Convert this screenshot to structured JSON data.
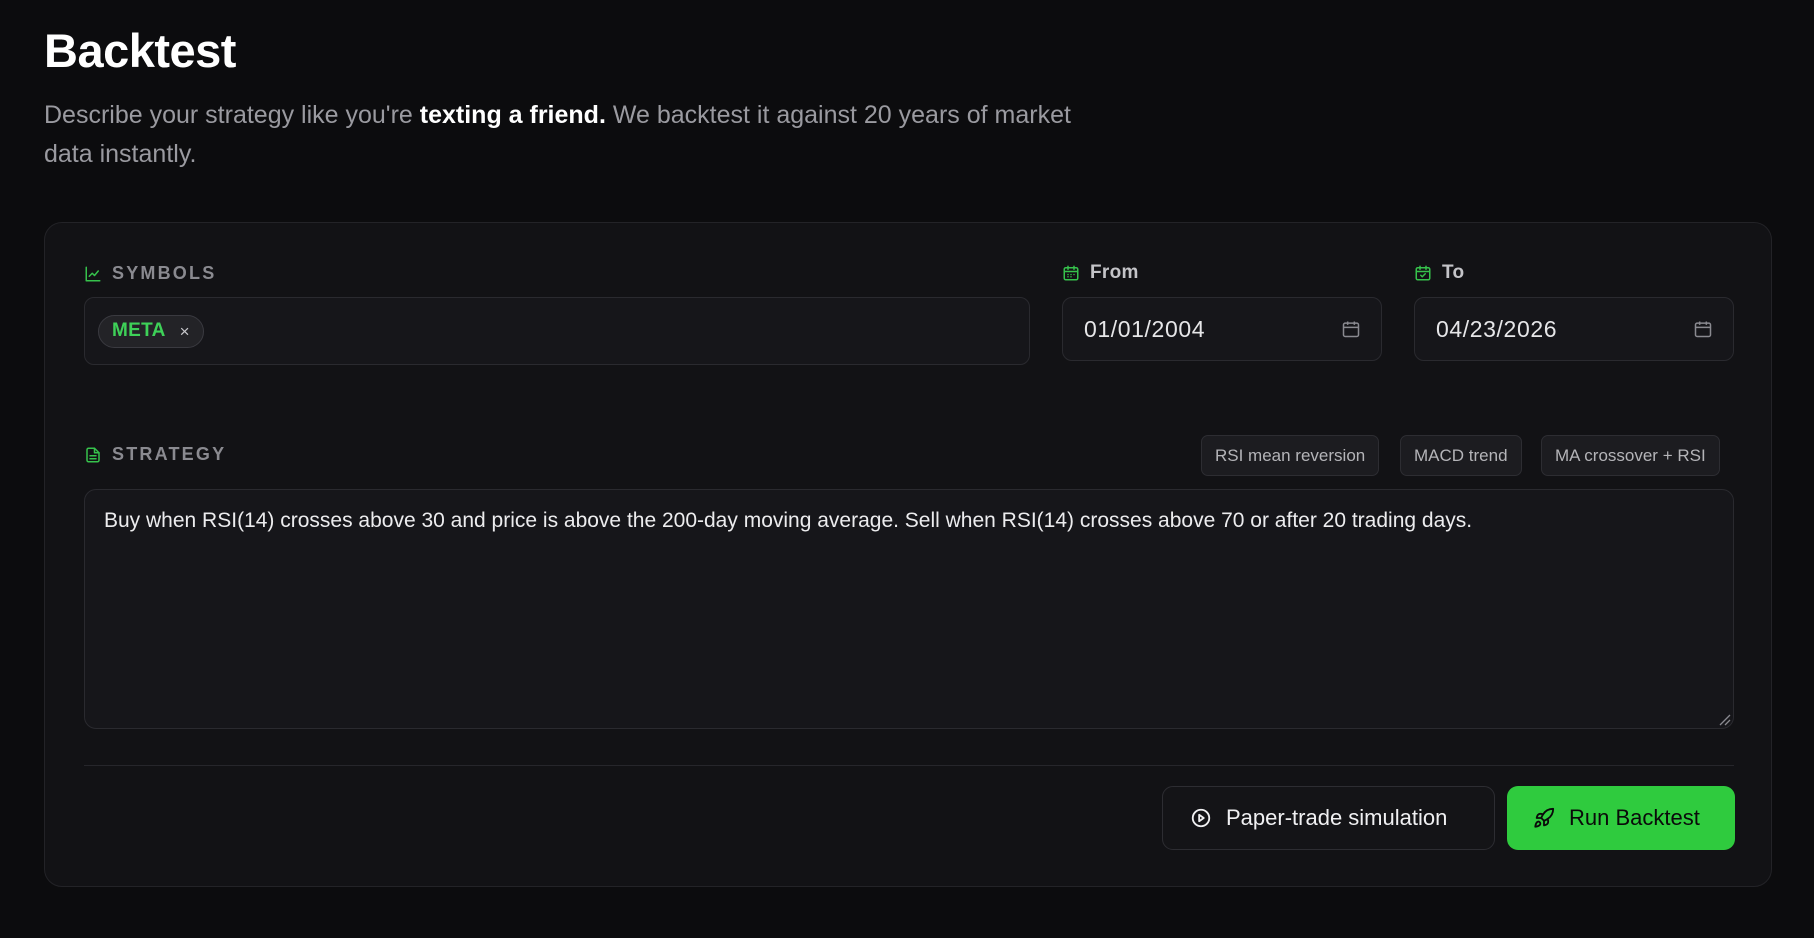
{
  "header": {
    "title": "Backtest",
    "subtitle_pre": "Describe your strategy like you're ",
    "subtitle_bold": "texting a friend.",
    "subtitle_post": " We backtest it against 20 years of market data instantly."
  },
  "symbols": {
    "label": "SYMBOLS",
    "icon": "line-chart-icon",
    "chips": [
      {
        "label": "META",
        "remove": "×"
      }
    ]
  },
  "from": {
    "label": "From",
    "icon": "calendar-icon",
    "value": "01/01/2004"
  },
  "to": {
    "label": "To",
    "icon": "calendar-check-icon",
    "value": "04/23/2026"
  },
  "strategy": {
    "label": "STRATEGY",
    "icon": "document-icon",
    "presets": [
      "RSI mean reversion",
      "MACD trend",
      "MA crossover + RSI"
    ],
    "text": "Buy when RSI(14) crosses above 30 and price is above the 200-day moving average. Sell when RSI(14) crosses above 70 or after 20 trading days."
  },
  "actions": {
    "paper_trade_label": "Paper-trade simulation",
    "paper_trade_icon": "play-circle-icon",
    "run_label": "Run Backtest",
    "run_icon": "rocket-icon"
  },
  "colors": {
    "background": "#0c0c0e",
    "card": "#121215",
    "accent_green": "#2fcb3e",
    "chip_text_green": "#3ed158"
  }
}
